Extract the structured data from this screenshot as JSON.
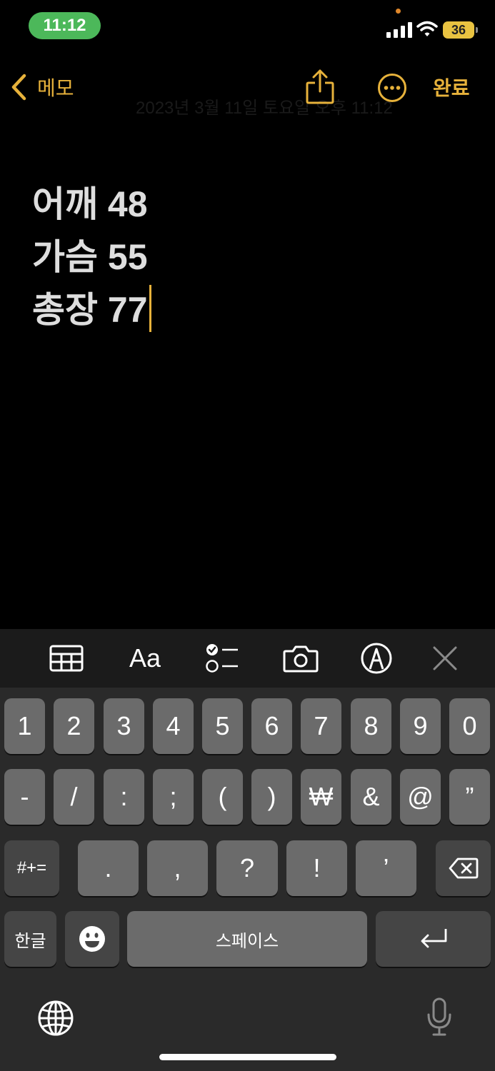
{
  "status_bar": {
    "time": "11:12",
    "battery_level": "36"
  },
  "nav": {
    "back_label": "메모",
    "ghost_date": "2023년 3월 11일 토요일 오후 11:12",
    "done_label": "완료",
    "accent_color": "#e7b23b"
  },
  "note": {
    "lines": [
      "어깨 48",
      "가슴 55",
      "총장 77"
    ]
  },
  "toolbar": {
    "items": [
      "table-icon",
      "Aa",
      "checklist-icon",
      "camera-icon",
      "markup-icon",
      "close-icon"
    ],
    "format_label": "Aa"
  },
  "keyboard": {
    "row1": [
      "1",
      "2",
      "3",
      "4",
      "5",
      "6",
      "7",
      "8",
      "9",
      "0"
    ],
    "row2": [
      "-",
      "/",
      ":",
      ";",
      "(",
      ")",
      "₩",
      "&",
      "@",
      "”"
    ],
    "row3": {
      "symbols_key": "#+=",
      "keys": [
        ".",
        ",",
        "?",
        "!",
        "’"
      ]
    },
    "row4": {
      "language_key": "한글",
      "space_label": "스페이스"
    }
  }
}
